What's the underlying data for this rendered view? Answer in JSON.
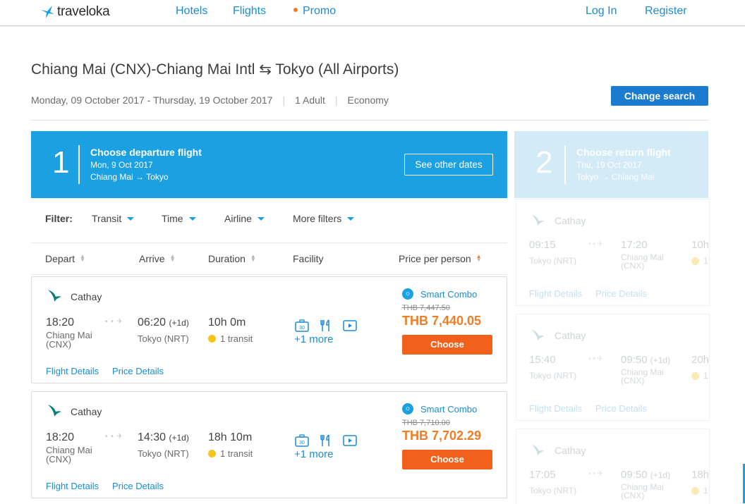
{
  "header": {
    "logo_text": "traveloka",
    "nav": [
      "Hotels",
      "Flights",
      "Promo"
    ],
    "login": "Log In",
    "register": "Register"
  },
  "search": {
    "route": "Chiang Mai (CNX)-Chiang Mai Intl ⇆ Tokyo (All Airports)",
    "dates": "Monday, 09 October 2017 - Thursday, 19 October 2017",
    "passengers": "1 Adult",
    "cabin": "Economy",
    "change_label": "Change search"
  },
  "steps": {
    "departure": {
      "number": "1",
      "title": "Choose departure flight",
      "date": "Mon, 9 Oct 2017",
      "route": "Chiang Mai → Tokyo",
      "see_dates": "See other dates"
    },
    "return": {
      "number": "2",
      "title": "Choose return flight",
      "date": "Thu, 19 Oct 2017",
      "route": "Tokyo → Chiang Mai"
    }
  },
  "filters": {
    "label": "Filter:",
    "items": [
      "Transit",
      "Time",
      "Airline",
      "More filters"
    ]
  },
  "sort": {
    "columns": [
      "Depart",
      "Arrive",
      "Duration",
      "Facility",
      "Price per person"
    ]
  },
  "flights": [
    {
      "airline": "Cathay",
      "dep_time": "18:20",
      "dep_place": "Chiang Mai (CNX)",
      "arr_time": "06:20",
      "arr_offset": "(+1d)",
      "arr_place": "Tokyo (NRT)",
      "duration": "10h 0m",
      "transit": "1 transit",
      "more": "+1 more",
      "combo": "Smart Combo",
      "old_price": "THB 7,447.50",
      "price": "THB 7,440.05",
      "choose": "Choose",
      "flight_details": "Flight Details",
      "price_details": "Price Details"
    },
    {
      "airline": "Cathay",
      "dep_time": "18:20",
      "dep_place": "Chiang Mai (CNX)",
      "arr_time": "14:30",
      "arr_offset": "(+1d)",
      "arr_place": "Tokyo (NRT)",
      "duration": "18h 10m",
      "transit": "1 transit",
      "more": "+1 more",
      "combo": "Smart Combo",
      "old_price": "THB 7,710.00",
      "price": "THB 7,702.29",
      "choose": "Choose",
      "flight_details": "Flight Details",
      "price_details": "Price Details"
    }
  ],
  "return_flights": [
    {
      "airline": "Cathay",
      "dep_time": "09:15",
      "dep_place": "Tokyo (NRT)",
      "arr_time": "17:20",
      "arr_offset": "",
      "arr_place": "Chiang Mai (CNX)",
      "duration": "10h",
      "transit": "1",
      "flight_details": "Flight Details",
      "price_details": "Price Details"
    },
    {
      "airline": "Cathay",
      "dep_time": "15:40",
      "dep_place": "Tokyo (NRT)",
      "arr_time": "09:50",
      "arr_offset": "(+1d)",
      "arr_place": "Chiang Mai (CNX)",
      "duration": "20h",
      "transit": "1",
      "flight_details": "Flight Details",
      "price_details": "Price Details"
    },
    {
      "airline": "Cathay",
      "dep_time": "17:05",
      "dep_place": "Tokyo (NRT)",
      "arr_time": "09:50",
      "arr_offset": "(+1d)",
      "arr_place": "Chiang Mai (CNX)",
      "duration": "18h",
      "transit": "1",
      "flight_details": "Flight Details",
      "price_details": "Price Details"
    }
  ],
  "colors": {
    "brand_blue": "#1ba0e2",
    "link_blue": "#1c8bd6",
    "price_orange": "#f07d25",
    "choose_orange": "#f1611b"
  }
}
